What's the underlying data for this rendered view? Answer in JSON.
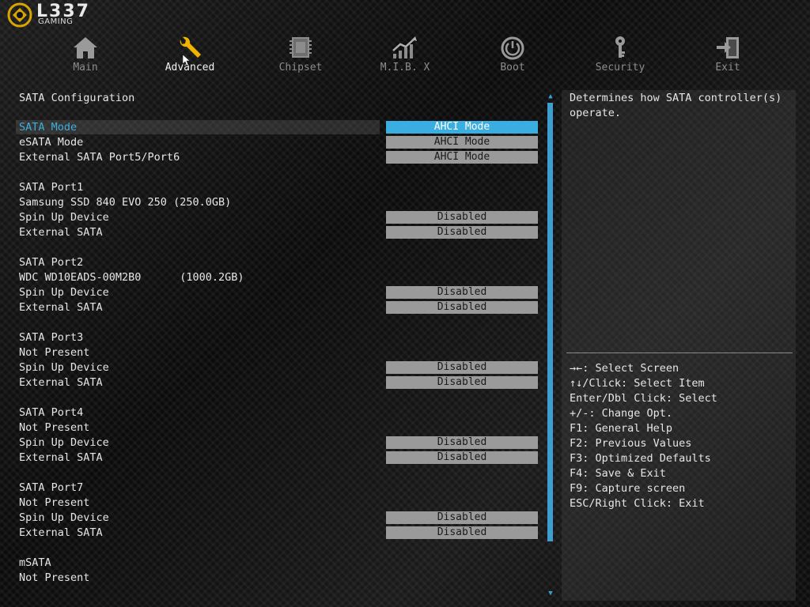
{
  "logo": {
    "brand": "L337",
    "sub": "GAMING"
  },
  "tabs": [
    {
      "label": "Main",
      "icon": "home-icon",
      "active": false
    },
    {
      "label": "Advanced",
      "icon": "wrench-icon",
      "active": true
    },
    {
      "label": "Chipset",
      "icon": "chip-icon",
      "active": false
    },
    {
      "label": "M.I.B. X",
      "icon": "chart-icon",
      "active": false
    },
    {
      "label": "Boot",
      "icon": "power-icon",
      "active": false
    },
    {
      "label": "Security",
      "icon": "key-icon",
      "active": false
    },
    {
      "label": "Exit",
      "icon": "exit-icon",
      "active": false
    }
  ],
  "main": {
    "section_title": "SATA Configuration",
    "sata_mode": {
      "label": "SATA Mode",
      "value": "AHCI Mode"
    },
    "esata_mode": {
      "label": "eSATA Mode",
      "value": "AHCI Mode"
    },
    "ext_port56": {
      "label": "External SATA Port5/Port6",
      "value": "AHCI Mode"
    },
    "ports": [
      {
        "name": "SATA Port1",
        "device": "Samsung SSD 840 EVO 250 (250.0GB)",
        "spin_label": "Spin Up Device",
        "spin_value": "Disabled",
        "ext_label": "External SATA",
        "ext_value": "Disabled"
      },
      {
        "name": "SATA Port2",
        "device": "WDC WD10EADS-00M2B0      (1000.2GB)",
        "spin_label": "Spin Up Device",
        "spin_value": "Disabled",
        "ext_label": "External SATA",
        "ext_value": "Disabled"
      },
      {
        "name": "SATA Port3",
        "device": "Not Present",
        "spin_label": "Spin Up Device",
        "spin_value": "Disabled",
        "ext_label": "External SATA",
        "ext_value": "Disabled"
      },
      {
        "name": "SATA Port4",
        "device": "Not Present",
        "spin_label": "Spin Up Device",
        "spin_value": "Disabled",
        "ext_label": "External SATA",
        "ext_value": "Disabled"
      },
      {
        "name": "SATA Port7",
        "device": "Not Present",
        "spin_label": "Spin Up Device",
        "spin_value": "Disabled",
        "ext_label": "External SATA",
        "ext_value": "Disabled"
      }
    ],
    "msata": {
      "name": "mSATA",
      "device": "Not Present"
    }
  },
  "help": {
    "description": "Determines how SATA controller(s) operate.",
    "keys": [
      "→←: Select Screen",
      "↑↓/Click: Select Item",
      "Enter/Dbl Click: Select",
      "+/-: Change Opt.",
      "F1: General Help",
      "F2: Previous Values",
      "F3: Optimized Defaults",
      "F4: Save & Exit",
      "F9: Capture screen",
      "ESC/Right Click: Exit"
    ]
  },
  "colors": {
    "accent": "#3aaee0",
    "value_bg": "#9a9a9a",
    "icon_gold": "#f0b400",
    "icon_grey": "#9a9a9a"
  }
}
